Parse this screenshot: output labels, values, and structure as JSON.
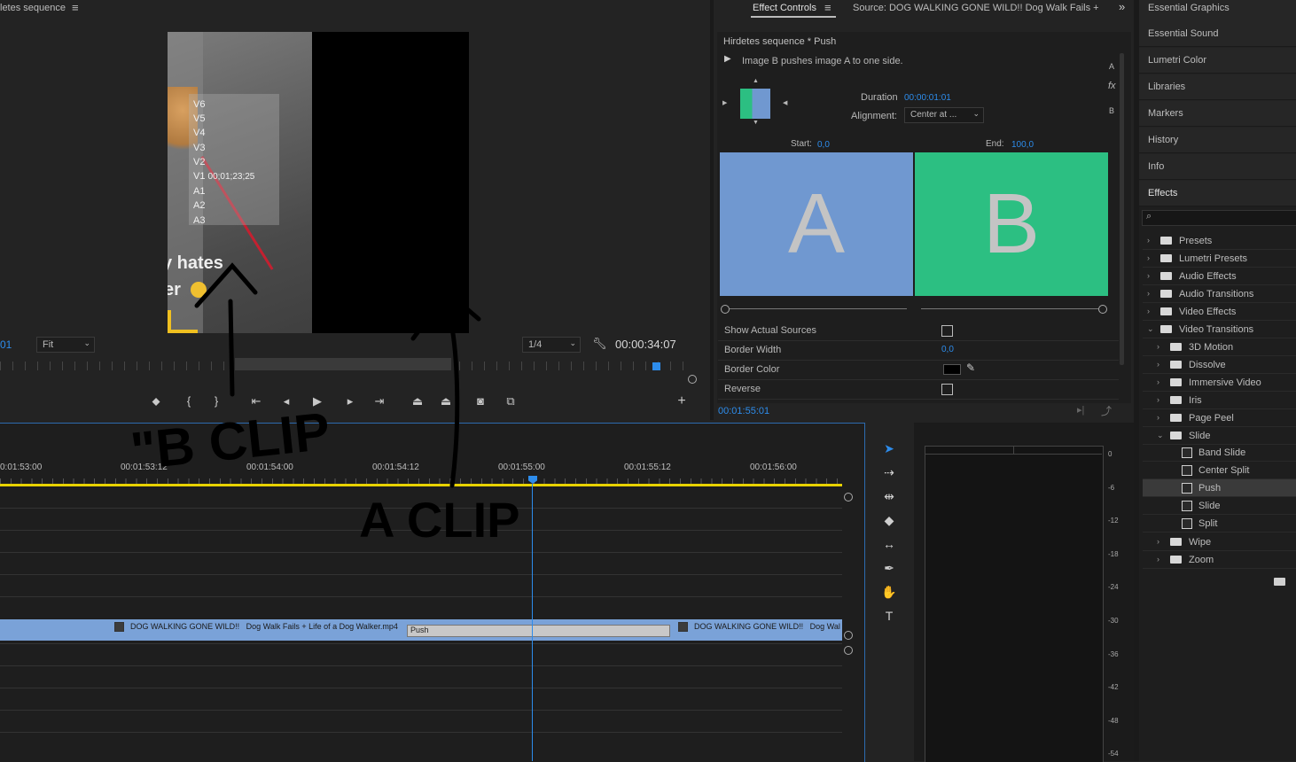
{
  "program_monitor": {
    "title": "letes sequence",
    "tracks_overlay": [
      "V6",
      "V5",
      "V4",
      "V3",
      "V2",
      "V1",
      "A1",
      "A2",
      "A3"
    ],
    "overlay_timecode": "00;01;23;25",
    "video_caption_1": "y hates",
    "video_caption_2": "er",
    "fit_value": "Fit",
    "resolution_value": "1/4",
    "timecode": "00:00:34:07",
    "left_timecode_partial": "01"
  },
  "effect_controls": {
    "tabs": [
      "Effect Controls",
      "Source: DOG WALKING GONE WILD!!  Dog Walk Fails +"
    ],
    "clip_title": "Hirdetes sequence * Push",
    "description": "Image B pushes image A to one side.",
    "duration_label": "Duration",
    "duration_value": "00:00:01:01",
    "alignment_label": "Alignment:",
    "alignment_value": "Center at ...",
    "start_label": "Start:",
    "start_value": "0,0",
    "end_label": "End:",
    "end_value": "100,0",
    "preview_a": "A",
    "preview_b": "B",
    "side_labels": [
      "A",
      "fx",
      "B"
    ],
    "properties": [
      {
        "label": "Show Actual Sources",
        "control": "checkbox"
      },
      {
        "label": "Border Width",
        "value": "0,0"
      },
      {
        "label": "Border Color",
        "control": "color"
      },
      {
        "label": "Reverse",
        "control": "checkbox"
      }
    ],
    "footer_timecode": "00:01:55:01"
  },
  "right_panel": {
    "items": [
      "Essential Graphics",
      "Essential Sound",
      "Lumetri Color",
      "Libraries",
      "Markers",
      "History",
      "Info",
      "Effects"
    ],
    "effects_tree": [
      {
        "label": "Presets",
        "level": 0,
        "type": "folder-star",
        "expanded": false
      },
      {
        "label": "Lumetri Presets",
        "level": 0,
        "type": "folder-star",
        "expanded": false
      },
      {
        "label": "Audio Effects",
        "level": 0,
        "type": "folder",
        "expanded": false
      },
      {
        "label": "Audio Transitions",
        "level": 0,
        "type": "folder",
        "expanded": false
      },
      {
        "label": "Video Effects",
        "level": 0,
        "type": "folder",
        "expanded": false
      },
      {
        "label": "Video Transitions",
        "level": 0,
        "type": "folder",
        "expanded": true
      },
      {
        "label": "3D Motion",
        "level": 1,
        "type": "folder",
        "expanded": false
      },
      {
        "label": "Dissolve",
        "level": 1,
        "type": "folder",
        "expanded": false
      },
      {
        "label": "Immersive Video",
        "level": 1,
        "type": "folder",
        "expanded": false
      },
      {
        "label": "Iris",
        "level": 1,
        "type": "folder",
        "expanded": false
      },
      {
        "label": "Page Peel",
        "level": 1,
        "type": "folder",
        "expanded": false
      },
      {
        "label": "Slide",
        "level": 1,
        "type": "folder",
        "expanded": true
      },
      {
        "label": "Band Slide",
        "level": 2,
        "type": "effect"
      },
      {
        "label": "Center Split",
        "level": 2,
        "type": "effect"
      },
      {
        "label": "Push",
        "level": 2,
        "type": "effect",
        "selected": true
      },
      {
        "label": "Slide",
        "level": 2,
        "type": "effect"
      },
      {
        "label": "Split",
        "level": 2,
        "type": "effect"
      },
      {
        "label": "Wipe",
        "level": 1,
        "type": "folder",
        "expanded": false
      },
      {
        "label": "Zoom",
        "level": 1,
        "type": "folder",
        "expanded": false
      }
    ]
  },
  "timeline": {
    "ruler_labels": [
      "0:01:53:00",
      "00:01:53:12",
      "00:01:54:00",
      "00:01:54:12",
      "00:01:55:00",
      "00:01:55:12",
      "00:01:56:00"
    ],
    "clip_a_name": "DOG WALKING GONE WILD!!   Dog Walk Fails + Life of a Dog Walker.mp4",
    "transition_label": "Push",
    "clip_b_name": "DOG WALKING GONE WILD!!   Dog Wal"
  },
  "audio_meter": {
    "ticks": [
      "0",
      "-6",
      "-12",
      "-18",
      "-24",
      "-30",
      "-36",
      "-42",
      "-48",
      "-54"
    ]
  },
  "annotations": {
    "b_clip": "\"B CLIP",
    "a_clip": "A CLIP"
  },
  "colors": {
    "accent_blue": "#2d8ceb",
    "preview_a_bg": "#7098d0",
    "preview_b_bg": "#2cbf82",
    "clip_bg": "#7aa2d8",
    "playhead_yellow": "#e8d200"
  }
}
